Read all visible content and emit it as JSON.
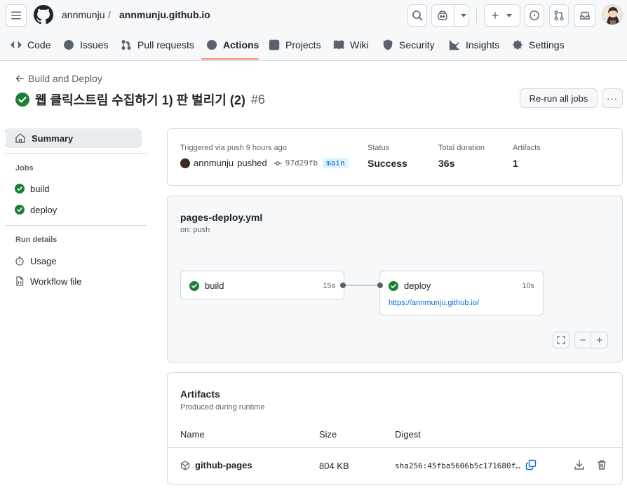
{
  "header": {
    "owner": "annmunju",
    "separator": "/",
    "repo": "annmunju.github.io",
    "plus_label": "+"
  },
  "tabs": [
    {
      "label": "Code",
      "icon": "code-icon"
    },
    {
      "label": "Issues",
      "icon": "issue-icon"
    },
    {
      "label": "Pull requests",
      "icon": "pull-request-icon"
    },
    {
      "label": "Actions",
      "icon": "play-icon",
      "active": true
    },
    {
      "label": "Projects",
      "icon": "table-icon"
    },
    {
      "label": "Wiki",
      "icon": "book-icon"
    },
    {
      "label": "Security",
      "icon": "shield-icon"
    },
    {
      "label": "Insights",
      "icon": "graph-icon"
    },
    {
      "label": "Settings",
      "icon": "gear-icon"
    }
  ],
  "run": {
    "back_label": "Build and Deploy",
    "title": "웹 클릭스트림 수집하기 1) 판 벌리기 (2)",
    "number": "#6",
    "rerun_label": "Re-run all jobs",
    "more_label": "···"
  },
  "sidebar": {
    "summary_label": "Summary",
    "jobs_heading": "Jobs",
    "jobs": [
      "build",
      "deploy"
    ],
    "run_details_heading": "Run details",
    "details": [
      {
        "label": "Usage",
        "icon": "stopwatch-icon"
      },
      {
        "label": "Workflow file",
        "icon": "file-code-icon"
      }
    ]
  },
  "summary": {
    "trigger_text": "Triggered via push 9 hours ago",
    "actor": "annmunju",
    "action": "pushed",
    "commit": "97d29fb",
    "branch": "main",
    "status_label": "Status",
    "status_value": "Success",
    "duration_label": "Total duration",
    "duration_value": "36s",
    "artifacts_label": "Artifacts",
    "artifacts_value": "1"
  },
  "workflow": {
    "file": "pages-deploy.yml",
    "trigger": "on: push",
    "jobs": [
      {
        "name": "build",
        "duration": "15s"
      },
      {
        "name": "deploy",
        "duration": "10s",
        "link": "https://annmunju.github.io/"
      }
    ],
    "zoom_out_label": "−",
    "zoom_in_label": "+"
  },
  "artifacts": {
    "title": "Artifacts",
    "subtitle": "Produced during runtime",
    "columns": [
      "Name",
      "Size",
      "Digest"
    ],
    "rows": [
      {
        "name": "github-pages",
        "size": "804 KB",
        "digest": "sha256:45fba5606b5c171680f…"
      }
    ]
  },
  "colors": {
    "success": "#1a7f37",
    "link": "#0969da",
    "accent_underline": "#fd8c73",
    "border": "#d1d9e0"
  }
}
